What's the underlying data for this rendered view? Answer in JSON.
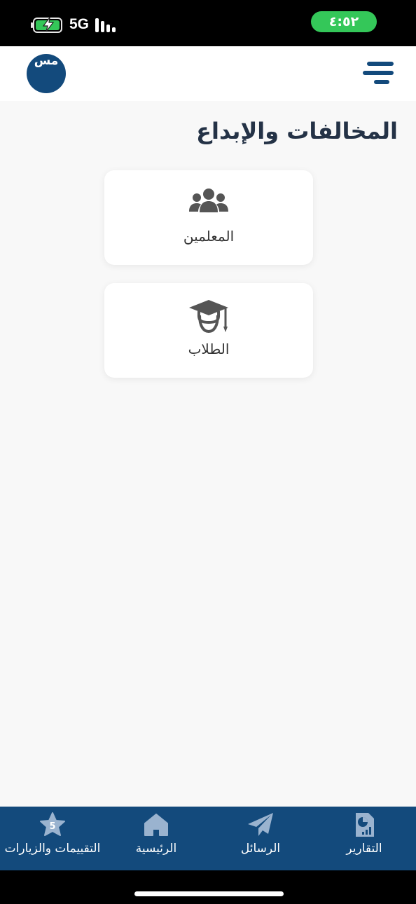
{
  "status_bar": {
    "time": "٤:٥٢",
    "network": "5G",
    "icons": [
      "battery-charging-icon",
      "signal-icon"
    ],
    "time_pill_color": "#34c759"
  },
  "header": {
    "avatar_initials": "مس",
    "menu_icon": "menu-icon",
    "brand_color": "#134a7c"
  },
  "page": {
    "title": "المخالفات والإبداع"
  },
  "cards": [
    {
      "label": "المعلمين",
      "icon": "users-group-icon"
    },
    {
      "label": "الطلاب",
      "icon": "graduate-student-icon"
    }
  ],
  "bottom_nav": {
    "items": [
      {
        "label": "التقييمات والزيارات",
        "icon": "star-icon",
        "badge": "5"
      },
      {
        "label": "الرئيسية",
        "icon": "home-icon"
      },
      {
        "label": "الرسائل",
        "icon": "paper-plane-icon"
      },
      {
        "label": "التقارير",
        "icon": "report-chart-icon"
      }
    ]
  }
}
